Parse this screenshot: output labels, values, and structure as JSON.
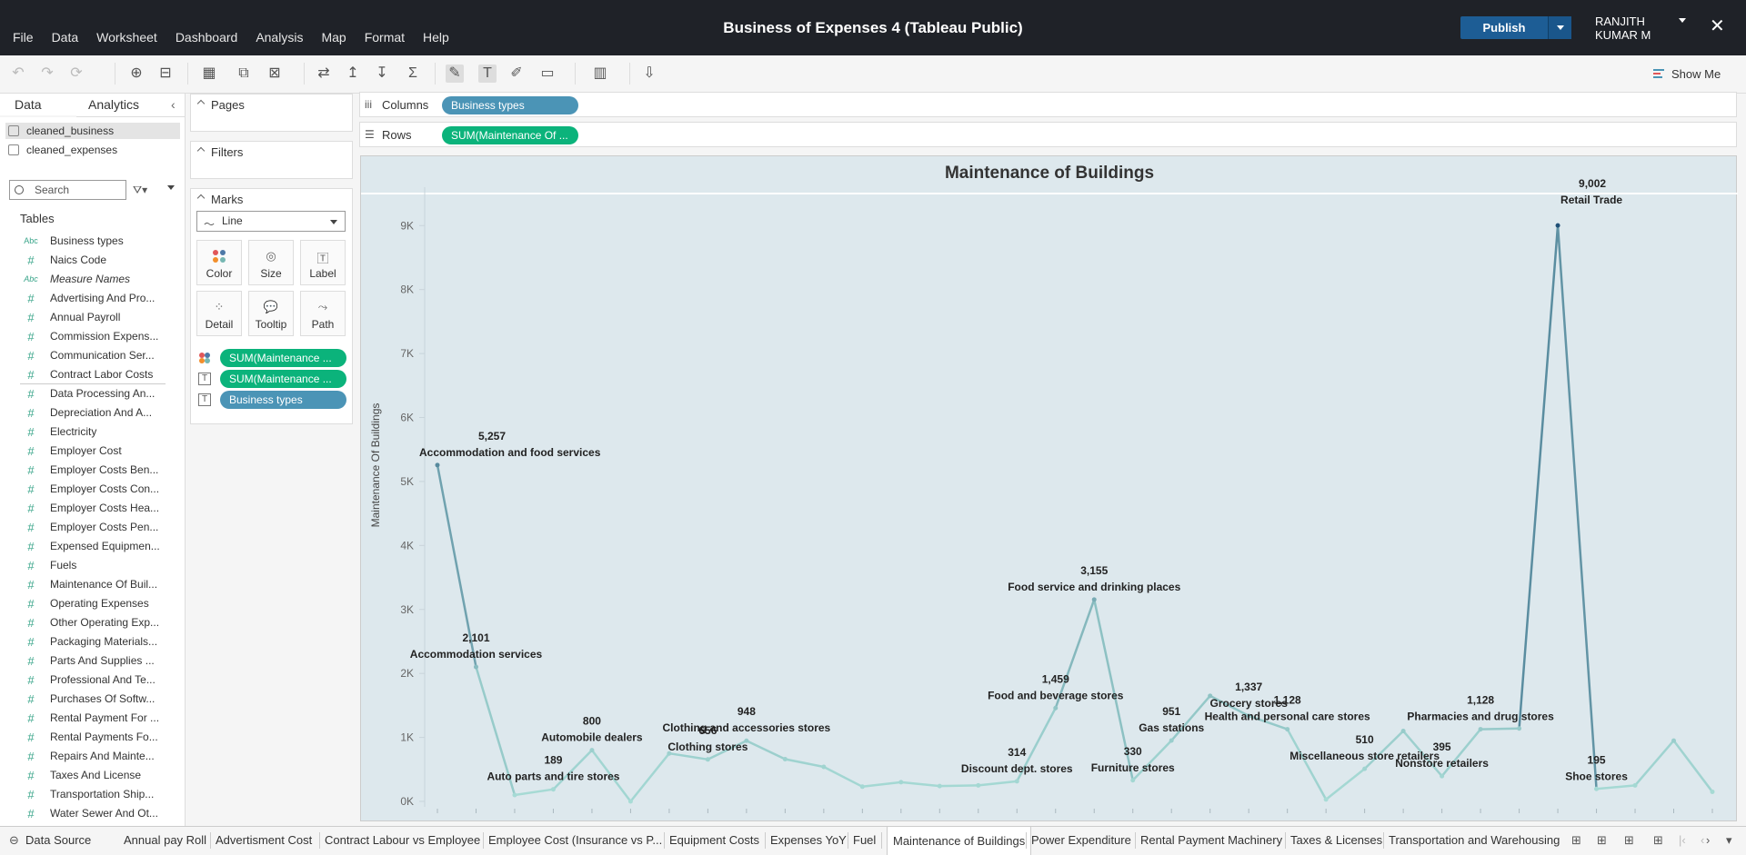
{
  "app": {
    "title": "Business of Expenses 4 (Tableau Public)",
    "menu": [
      "File",
      "Data",
      "Worksheet",
      "Dashboard",
      "Analysis",
      "Map",
      "Format",
      "Help"
    ],
    "publish_label": "Publish",
    "user_line1": "RANJITH",
    "user_line2": "KUMAR M",
    "close_glyph": "✕",
    "show_me_label": "Show Me"
  },
  "left": {
    "tab_data": "Data",
    "tab_analytics": "Analytics",
    "datasources": [
      "cleaned_business",
      "cleaned_expenses"
    ],
    "search_placeholder": "Search",
    "tables_heading": "Tables",
    "fields": [
      {
        "type": "Abc",
        "name": "Business types",
        "italic": false
      },
      {
        "type": "#",
        "name": "Naics Code",
        "italic": false
      },
      {
        "type": "Abc",
        "name": "Measure Names",
        "italic": true
      },
      {
        "type": "#",
        "name": "Advertising And Pro...",
        "italic": false
      },
      {
        "type": "#",
        "name": "Annual Payroll",
        "italic": false
      },
      {
        "type": "#",
        "name": "Commission Expens...",
        "italic": false
      },
      {
        "type": "#",
        "name": "Communication Ser...",
        "italic": false
      },
      {
        "type": "#",
        "name": "Contract Labor Costs",
        "italic": false
      },
      {
        "type": "#",
        "name": "Data Processing An...",
        "italic": false
      },
      {
        "type": "#",
        "name": "Depreciation And A...",
        "italic": false
      },
      {
        "type": "#",
        "name": "Electricity",
        "italic": false
      },
      {
        "type": "#",
        "name": "Employer Cost",
        "italic": false
      },
      {
        "type": "#",
        "name": "Employer Costs Ben...",
        "italic": false
      },
      {
        "type": "#",
        "name": "Employer Costs Con...",
        "italic": false
      },
      {
        "type": "#",
        "name": "Employer Costs Hea...",
        "italic": false
      },
      {
        "type": "#",
        "name": "Employer Costs Pen...",
        "italic": false
      },
      {
        "type": "#",
        "name": "Expensed Equipmen...",
        "italic": false
      },
      {
        "type": "#",
        "name": "Fuels",
        "italic": false
      },
      {
        "type": "#",
        "name": "Maintenance Of Buil...",
        "italic": false
      },
      {
        "type": "#",
        "name": "Operating Expenses",
        "italic": false
      },
      {
        "type": "#",
        "name": "Other Operating Exp...",
        "italic": false
      },
      {
        "type": "#",
        "name": "Packaging Materials...",
        "italic": false
      },
      {
        "type": "#",
        "name": "Parts And Supplies ...",
        "italic": false
      },
      {
        "type": "#",
        "name": "Professional And Te...",
        "italic": false
      },
      {
        "type": "#",
        "name": "Purchases Of Softw...",
        "italic": false
      },
      {
        "type": "#",
        "name": "Rental Payment For ...",
        "italic": false
      },
      {
        "type": "#",
        "name": "Rental Payments Fo...",
        "italic": false
      },
      {
        "type": "#",
        "name": "Repairs And Mainte...",
        "italic": false
      },
      {
        "type": "#",
        "name": "Taxes And License",
        "italic": false
      },
      {
        "type": "#",
        "name": "Transportation Ship...",
        "italic": false
      },
      {
        "type": "#",
        "name": "Water Sewer And Ot...",
        "italic": false
      }
    ]
  },
  "cards": {
    "pages": "Pages",
    "filters": "Filters",
    "marks": "Marks",
    "mark_type": "Line",
    "mark_buttons": [
      "Color",
      "Size",
      "Label",
      "Detail",
      "Tooltip",
      "Path"
    ],
    "mark_pills": [
      {
        "icon": "color-icon",
        "label": "SUM(Maintenance ...",
        "color": "green"
      },
      {
        "icon": "label-icon",
        "label": "SUM(Maintenance ...",
        "color": "green"
      },
      {
        "icon": "label-icon",
        "label": "Business types",
        "color": "blue"
      }
    ]
  },
  "shelves": {
    "columns_label": "Columns",
    "columns_pill": "Business types",
    "rows_label": "Rows",
    "rows_pill": "SUM(Maintenance Of ..."
  },
  "chart_data": {
    "type": "line",
    "title": "Maintenance of Buildings",
    "ylabel": "Maintenance Of Buildings",
    "xlabel": "",
    "ylim": [
      0,
      9600
    ],
    "yticks": [
      {
        "v": 0,
        "t": "0K"
      },
      {
        "v": 1000,
        "t": "1K"
      },
      {
        "v": 2000,
        "t": "2K"
      },
      {
        "v": 3000,
        "t": "3K"
      },
      {
        "v": 4000,
        "t": "4K"
      },
      {
        "v": 5000,
        "t": "5K"
      },
      {
        "v": 6000,
        "t": "6K"
      },
      {
        "v": 7000,
        "t": "7K"
      },
      {
        "v": 8000,
        "t": "8K"
      },
      {
        "v": 9000,
        "t": "9K"
      }
    ],
    "color_scale": [
      "#a8dcd6",
      "#1e4f76"
    ],
    "points": [
      {
        "value": 5257,
        "label_value": "5,257",
        "label_name": "Accommodation and food services"
      },
      {
        "value": 2101,
        "label_value": "2,101",
        "label_name": "Accommodation services"
      },
      {
        "value": 100
      },
      {
        "value": 189,
        "label_value": "189",
        "label_name": "Auto parts and tire stores"
      },
      {
        "value": 800,
        "label_value": "800",
        "label_name": "Automobile dealers"
      },
      {
        "value": 0
      },
      {
        "value": 750
      },
      {
        "value": 656,
        "label_value": "656",
        "label_name": "Clothing stores"
      },
      {
        "value": 948,
        "label_value": "948",
        "label_name": "Clothing and accessories stores"
      },
      {
        "value": 660
      },
      {
        "value": 540
      },
      {
        "value": 230
      },
      {
        "value": 300
      },
      {
        "value": 240
      },
      {
        "value": 250
      },
      {
        "value": 314,
        "label_value": "314",
        "label_name": "Discount dept. stores"
      },
      {
        "value": 1459,
        "label_value": "1,459",
        "label_name": "Food and beverage stores"
      },
      {
        "value": 3155,
        "label_value": "3,155",
        "label_name": "Food service and drinking places"
      },
      {
        "value": 330,
        "label_value": "330",
        "label_name": "Furniture stores"
      },
      {
        "value": 951,
        "label_value": "951",
        "label_name": "Gas stations"
      },
      {
        "value": 1650
      },
      {
        "value": 1337,
        "label_value": "1,337",
        "label_name": "Grocery stores"
      },
      {
        "value": 1128,
        "label_value": "1,128",
        "label_name": "Health and personal care stores"
      },
      {
        "value": 30
      },
      {
        "value": 510,
        "label_value": "510",
        "label_name": "Miscellaneous store retailers"
      },
      {
        "value": 1100
      },
      {
        "value": 395,
        "label_value": "395",
        "label_name": "Nonstore retailers"
      },
      {
        "value": 1128,
        "label_value": "1,128",
        "label_name": "Pharmacies and drug stores"
      },
      {
        "value": 1140
      },
      {
        "value": 9002,
        "label_value": "9,002",
        "label_name": "Retail Trade"
      },
      {
        "value": 195,
        "label_value": "195",
        "label_name": "Shoe stores"
      },
      {
        "value": 250
      },
      {
        "value": 950
      },
      {
        "value": 150
      }
    ]
  },
  "sheets": {
    "datasource_tab": "Data Source",
    "tabs": [
      "Annual pay Roll",
      "Advertisment Cost",
      "Contract Labour vs Employee",
      "Employee Cost (Insurance vs P...",
      "Equipment Costs",
      "Expenses YoY",
      "Fuel",
      "Maintenance of Buildings",
      "Power Expenditure",
      "Rental Payment Machinery",
      "Taxes & Licenses",
      "Transportation and Warehousing"
    ],
    "active_index": 7
  }
}
